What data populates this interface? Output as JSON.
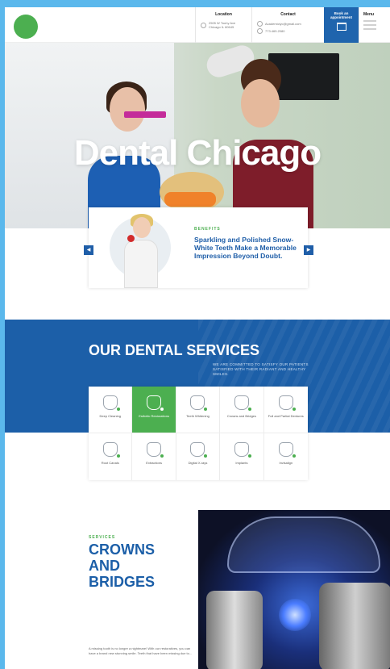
{
  "header": {
    "location": {
      "title": "Location",
      "lines": [
        "2505 W Touhy Ave",
        "Chicago IL 60645"
      ]
    },
    "contact": {
      "title": "Contact",
      "lines": [
        "Academiclyc@gmail.com",
        "773.465.2080"
      ]
    },
    "book": {
      "line1": "Book an",
      "line2": "appointment"
    },
    "menu": {
      "title": "Menu"
    }
  },
  "hero": {
    "title": "Dental Chicago"
  },
  "benefit_card": {
    "label": "BENEFITS",
    "text": "Sparkling and Polished Snow-White Teeth Make a Memorable Impression Beyond Doubt.",
    "prev": "◀",
    "next": "▶"
  },
  "services": {
    "title": "OUR DENTAL SERVICES",
    "description": "WE ARE COMMITTED TO SATISFY OUR PATIENTS SATISFIED WITH THEIR RADIANT AND HEALTHY SMILES.",
    "items": [
      {
        "label": "Deep Cleaning",
        "icon": "cleaning-icon"
      },
      {
        "label": "Esthetic Restorations",
        "icon": "tooth-icon"
      },
      {
        "label": "Teeth Whitening",
        "icon": "whitening-icon"
      },
      {
        "label": "Crowns and Bridges",
        "icon": "bridge-icon"
      },
      {
        "label": "Full and Partial Dentures",
        "icon": "dentures-icon"
      },
      {
        "label": "Root Canals",
        "icon": "root-canal-icon"
      },
      {
        "label": "Extractions",
        "icon": "extraction-icon"
      },
      {
        "label": "Digital X-rays",
        "icon": "xray-icon"
      },
      {
        "label": "Implants",
        "icon": "implant-icon"
      },
      {
        "label": "Invisalign",
        "icon": "invisalign-icon"
      }
    ]
  },
  "crowns": {
    "label": "SERVICES",
    "title": "CROWNS AND BRIDGES",
    "text": "A missing tooth is no longer a nightmare! With our restoratives, you can have a brand new stunning smile. Teeth that have been missing due to..."
  },
  "colors": {
    "brand_blue": "#1c5fa8",
    "accent_green": "#4caf50"
  }
}
